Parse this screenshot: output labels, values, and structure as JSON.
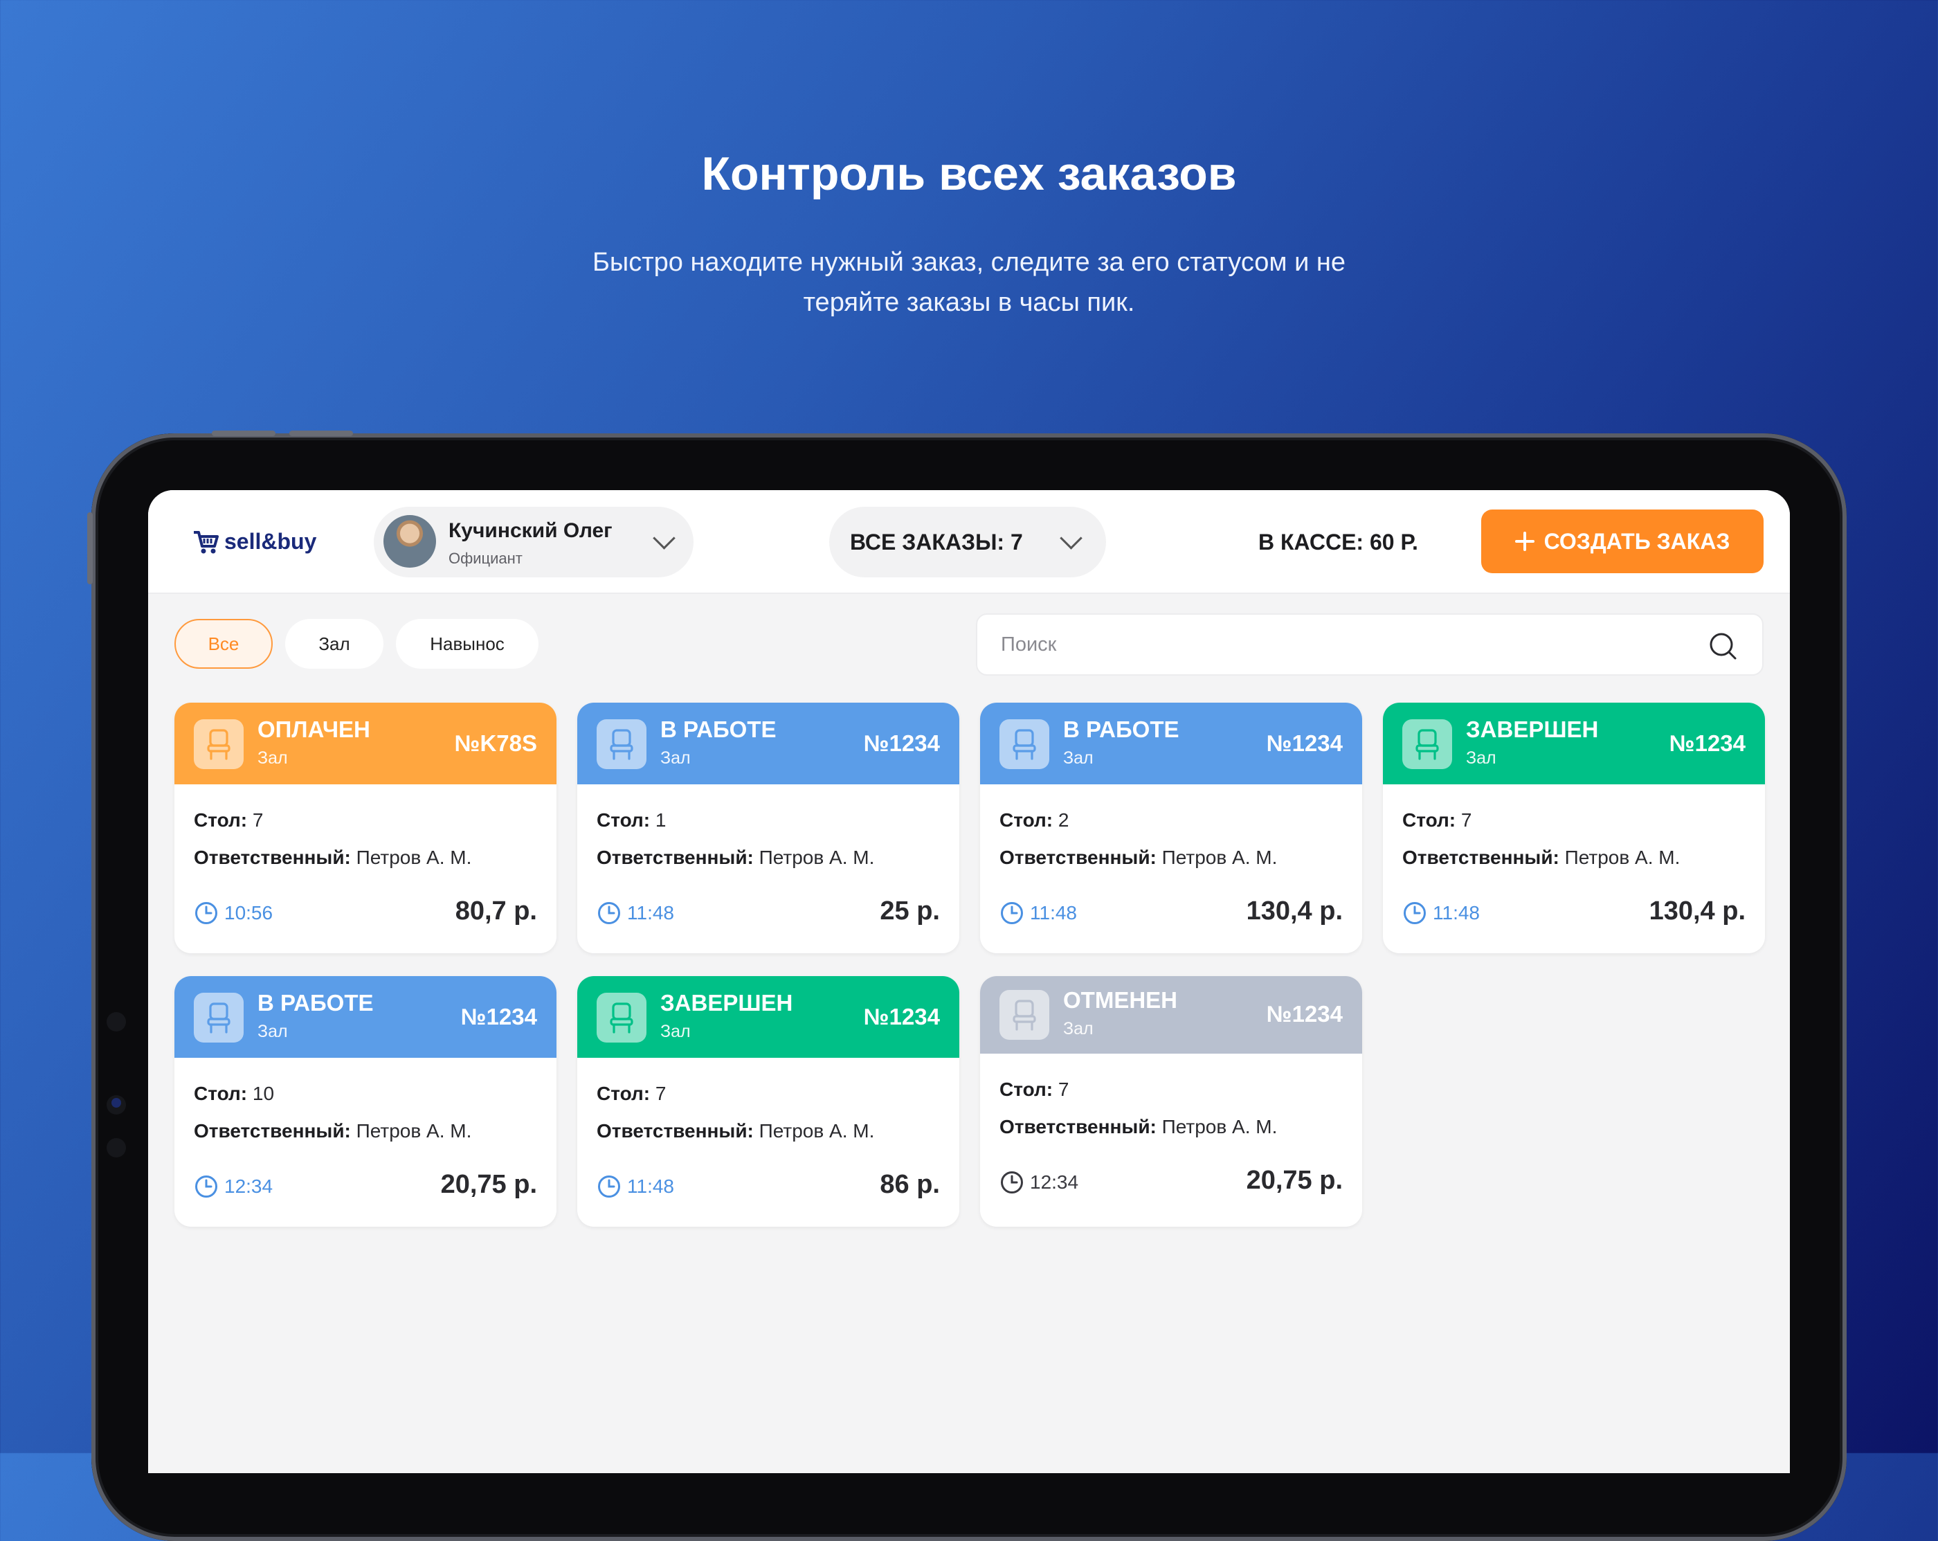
{
  "hero": {
    "title": "Контроль всех заказов",
    "subtitle_line1": "Быстро находите нужный заказ, следите за его статусом и не",
    "subtitle_line2": "теряйте заказы в часы пик."
  },
  "header": {
    "logo": "sell&buy",
    "user_name": "Кучинский Олег",
    "user_role": "Официант",
    "orders_label": "ВСЕ ЗАКАЗЫ: 7",
    "cash_label": "В КАССЕ: 60 Р.",
    "create_button": "СОЗДАТЬ ЗАКАЗ"
  },
  "filters": {
    "all": "Все",
    "hall": "Зал",
    "takeaway": "Навынос",
    "search_placeholder": "Поиск"
  },
  "colors": {
    "paid": "#ffa63f",
    "in_work": "#5b9de8",
    "done": "#00c087",
    "cancelled": "#b8c0cf",
    "accent": "#ff8a23"
  },
  "card_labels": {
    "table": "Стол:",
    "responsible": "Ответственный:"
  },
  "orders": [
    {
      "status": "ОПЛАЧЕН",
      "type": "Зал",
      "number": "№K78S",
      "table": "7",
      "responsible": "Петров А. М.",
      "time": "10:56",
      "price": "80,7 р."
    },
    {
      "status": "В РАБОТЕ",
      "type": "Зал",
      "number": "№1234",
      "table": "1",
      "responsible": "Петров А. М.",
      "time": "11:48",
      "price": "25 р."
    },
    {
      "status": "В РАБОТЕ",
      "type": "Зал",
      "number": "№1234",
      "table": "2",
      "responsible": "Петров А. М.",
      "time": "11:48",
      "price": "130,4 р."
    },
    {
      "status": "ЗАВЕРШЕН",
      "type": "Зал",
      "number": "№1234",
      "table": "7",
      "responsible": "Петров А. М.",
      "time": "11:48",
      "price": "130,4 р."
    },
    {
      "status": "В РАБОТЕ",
      "type": "Зал",
      "number": "№1234",
      "table": "10",
      "responsible": "Петров А. М.",
      "time": "12:34",
      "price": "20,75 р."
    },
    {
      "status": "ЗАВЕРШЕН",
      "type": "Зал",
      "number": "№1234",
      "table": "7",
      "responsible": "Петров А. М.",
      "time": "11:48",
      "price": "86 р."
    },
    {
      "status": "ОТМЕНЕН",
      "type": "Зал",
      "number": "№1234",
      "table": "7",
      "responsible": "Петров А. М.",
      "time": "12:34",
      "price": "20,75 р."
    }
  ]
}
